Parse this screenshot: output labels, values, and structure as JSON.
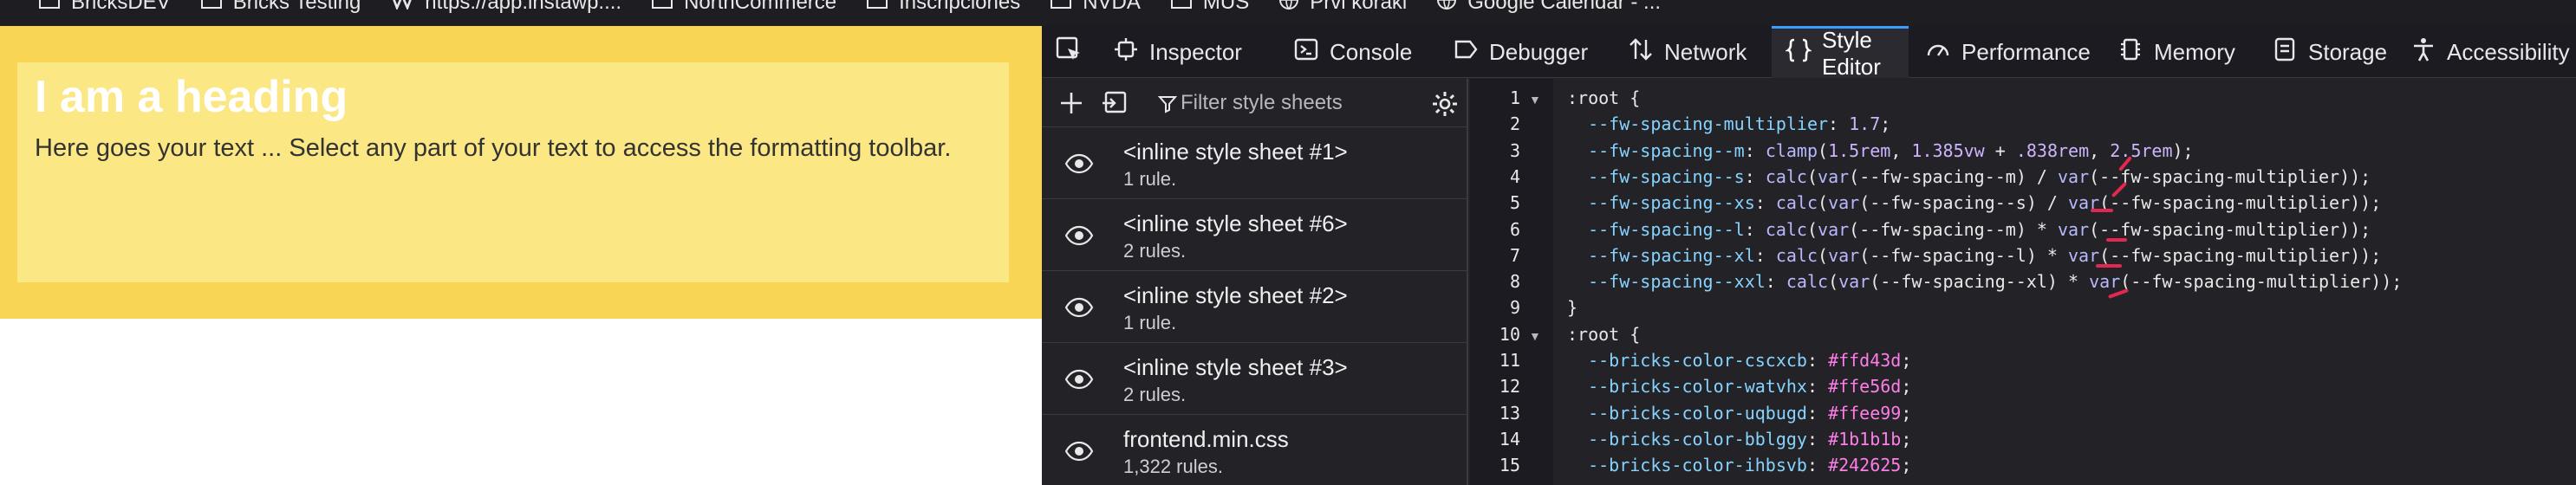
{
  "bookmarks": [
    {
      "label": "BricksDEV",
      "icon": "folder-icon"
    },
    {
      "label": "Bricks Testing",
      "icon": "folder-icon"
    },
    {
      "label": "https://app.instawp....",
      "icon": "instawp-icon"
    },
    {
      "label": "NorthCommerce",
      "icon": "folder-icon"
    },
    {
      "label": "Inscripciones",
      "icon": "folder-icon"
    },
    {
      "label": "NVDA",
      "icon": "folder-icon"
    },
    {
      "label": "MUS",
      "icon": "folder-icon"
    },
    {
      "label": "Prvi koraki",
      "icon": "globe-icon"
    },
    {
      "label": "Google Calendar - ...",
      "icon": "globe-icon"
    }
  ],
  "page": {
    "heading": "I am a heading",
    "text": "Here goes your text ... Select any part of your text to access the formatting toolbar.",
    "colors": {
      "section": "#f9d556",
      "container": "#fbe783"
    }
  },
  "devtools": {
    "tabs": [
      {
        "label": "",
        "icon": "pick-element-icon"
      },
      {
        "label": "Inspector",
        "icon": "inspector-icon"
      },
      {
        "label": "Console",
        "icon": "console-icon"
      },
      {
        "label": "Debugger",
        "icon": "debugger-icon"
      },
      {
        "label": "Network",
        "icon": "network-icon"
      },
      {
        "label": "Style Editor",
        "icon": "braces-icon",
        "active": true
      },
      {
        "label": "Performance",
        "icon": "performance-icon"
      },
      {
        "label": "Memory",
        "icon": "memory-icon"
      },
      {
        "label": "Storage",
        "icon": "storage-icon"
      },
      {
        "label": "Accessibility",
        "icon": "accessibility-icon"
      }
    ],
    "filter_placeholder": "Filter style sheets",
    "sheets": [
      {
        "name": "<inline style sheet #1>",
        "rules": "1 rule."
      },
      {
        "name": "<inline style sheet #6>",
        "rules": "2 rules."
      },
      {
        "name": "<inline style sheet #2>",
        "rules": "1 rule."
      },
      {
        "name": "<inline style sheet #3>",
        "rules": "2 rules."
      },
      {
        "name": "frontend.min.css",
        "rules": "1,322 rules."
      }
    ],
    "code_lines": [
      {
        "n": "1",
        "text": ":root {"
      },
      {
        "n": "2",
        "text": "  --fw-spacing-multiplier: 1.7;"
      },
      {
        "n": "3",
        "text": "  --fw-spacing--m: clamp(1.5rem, 1.385vw + .838rem, 2.5rem);"
      },
      {
        "n": "4",
        "text": "  --fw-spacing--s: calc(var(--fw-spacing--m) / var(--fw-spacing-multiplier));"
      },
      {
        "n": "5",
        "text": "  --fw-spacing--xs: calc(var(--fw-spacing--s) / var(--fw-spacing-multiplier));"
      },
      {
        "n": "6",
        "text": "  --fw-spacing--l: calc(var(--fw-spacing--m) * var(--fw-spacing-multiplier));"
      },
      {
        "n": "7",
        "text": "  --fw-spacing--xl: calc(var(--fw-spacing--l) * var(--fw-spacing-multiplier));"
      },
      {
        "n": "8",
        "text": "  --fw-spacing--xxl: calc(var(--fw-spacing--xl) * var(--fw-spacing-multiplier));"
      },
      {
        "n": "9",
        "text": "}"
      },
      {
        "n": "10",
        "text": ":root {"
      },
      {
        "n": "11",
        "text": "  --bricks-color-cscxcb: #ffd43d;"
      },
      {
        "n": "12",
        "text": "  --bricks-color-watvhx: #ffe56d;"
      },
      {
        "n": "13",
        "text": "  --bricks-color-uqbugd: #ffee99;"
      },
      {
        "n": "14",
        "text": "  --bricks-color-bblggy: #1b1b1b;"
      },
      {
        "n": "15",
        "text": "  --bricks-color-ihbsvb: #242625;"
      }
    ],
    "colors": {
      "accent": "#3d9aff",
      "annotation": "#e22850"
    }
  }
}
